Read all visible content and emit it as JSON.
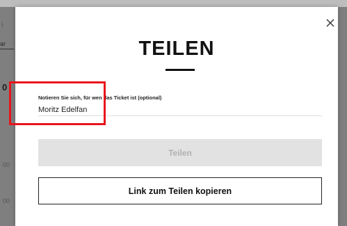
{
  "background": {
    "fragments": [
      "i",
      "ar",
      "0",
      "00",
      "00"
    ]
  },
  "dialog": {
    "title": "TEILEN",
    "close_glyph": "×",
    "field": {
      "label": "Notieren Sie sich, für wen das Ticket ist (optional)",
      "value": "Moritz Edelfan"
    },
    "share_button": {
      "label": "Teilen",
      "state": "disabled"
    },
    "copy_link_button": {
      "label": "Link zum Teilen kopieren"
    }
  },
  "annotation": {
    "highlight_color": "#e8141c",
    "target": "ticket-name-field"
  },
  "colors": {
    "accent": "#111111",
    "disabled_button_bg": "#e2e2e2",
    "disabled_button_text": "#b0b0b0",
    "overlay": "#8c8c8c"
  }
}
